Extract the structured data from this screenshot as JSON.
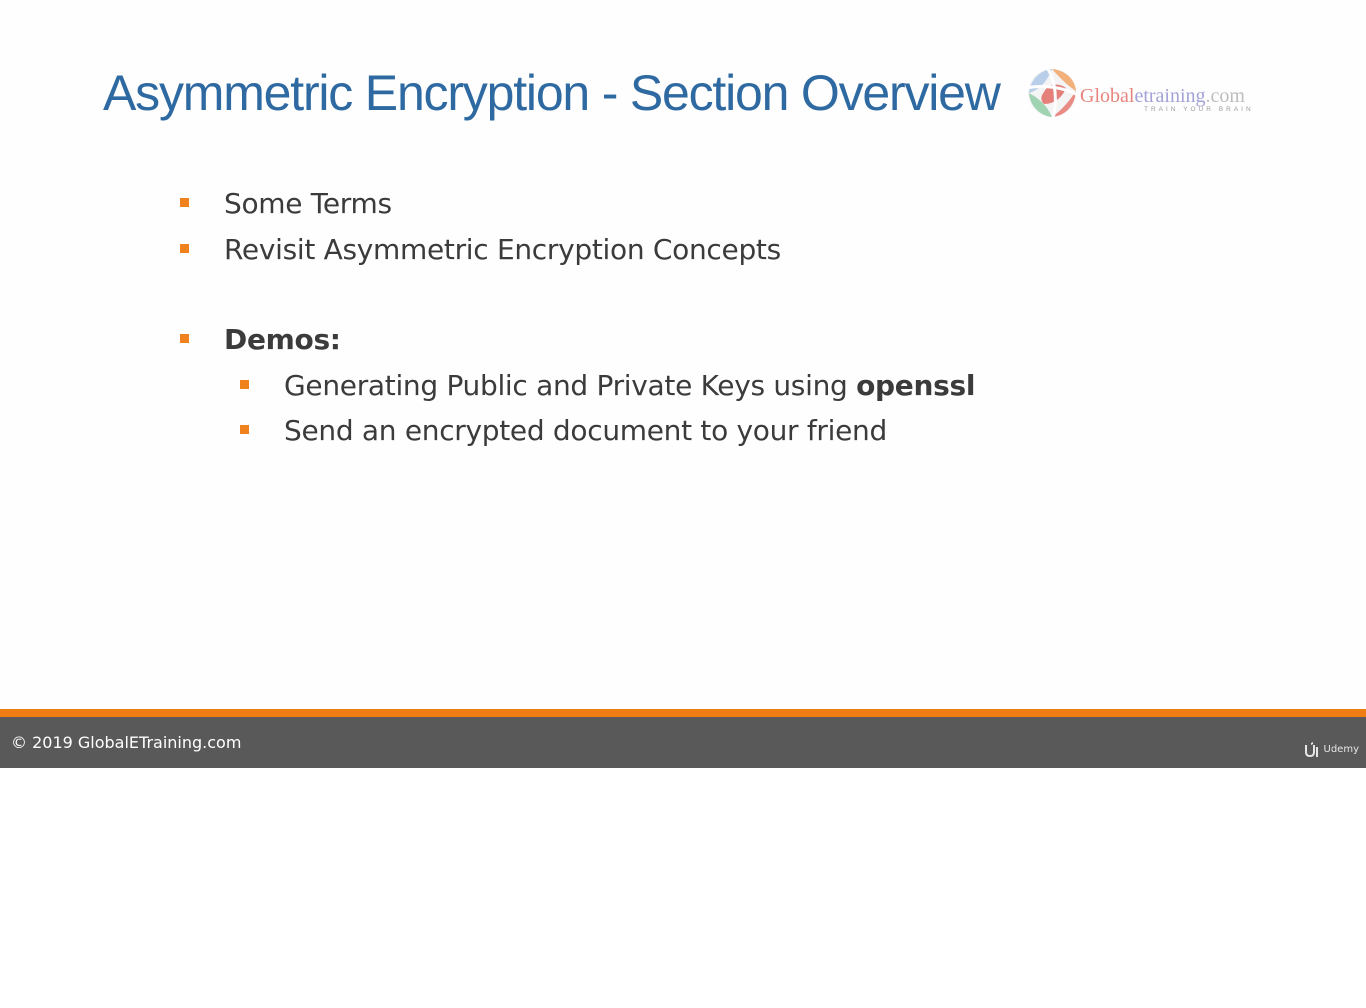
{
  "slide": {
    "title": "Asymmetric Encryption - Section Overview",
    "logo": {
      "word_part1": "Global",
      "word_part2": "etraining",
      "word_part3": ".com",
      "tagline": "TRAIN YOUR BRAIN"
    },
    "bullets": [
      {
        "text": "Some Terms"
      },
      {
        "text": "Revisit Asymmetric Encryption Concepts"
      },
      {
        "text": "Demos:"
      }
    ],
    "sub_bullets": [
      {
        "text": "Generating Public and Private Keys using ",
        "bold_text": "openssl"
      },
      {
        "text": "Send an encrypted document to your friend"
      }
    ]
  },
  "footer": {
    "copyright": "© 2019 GlobalETraining.com",
    "player_brand": "Udemy"
  },
  "colors": {
    "title": "#2e6aa1",
    "bullet_marker": "#f0821e",
    "footer_stripe": "#ee7d14",
    "footer_bar": "#595959"
  },
  "icons": {
    "logo": "globe-logo-icon",
    "player": "udemy-icon"
  }
}
